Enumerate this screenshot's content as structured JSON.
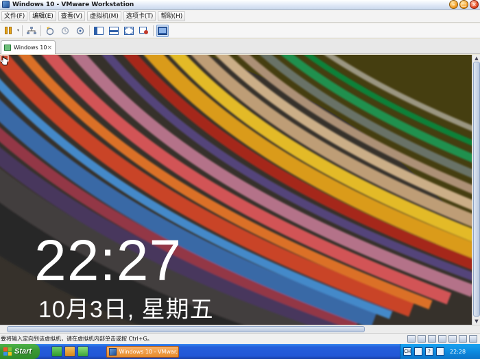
{
  "window": {
    "title": "Windows 10 - VMware Workstation",
    "buttons": {
      "minimize": "–",
      "maximize": "□",
      "close": "×"
    }
  },
  "menu": {
    "items": [
      "文件(F)",
      "编辑(E)",
      "查看(V)",
      "虚拟机(M)",
      "选项卡(T)",
      "帮助(H)"
    ]
  },
  "toolbar": {
    "icons": [
      "pause-icon",
      "network-icon",
      "snapshot-take-icon",
      "snapshot-revert-icon",
      "snapshot-manager-icon",
      "view-normal-icon",
      "view-quick-switch-icon",
      "view-fullscreen-icon",
      "view-unity-icon",
      "view-console-icon"
    ]
  },
  "tab": {
    "label": "Windows 10",
    "close": "×"
  },
  "vm": {
    "clock": "22:27",
    "date": "10月3日, 星期五"
  },
  "status": {
    "message": "要将输入定向到该虚拟机，请在虚拟机内部单击或按 Ctrl+G。"
  },
  "taskbar": {
    "start_label": "Start",
    "task_label": "Windows 10 - VMwar...",
    "time": "22:28",
    "tray_lang": "CH"
  },
  "colors": {
    "taskbar": "#245edb",
    "start_green": "#3b9a35",
    "task_orange": "#e68a2a",
    "tray_blue": "#0d8ae0"
  }
}
